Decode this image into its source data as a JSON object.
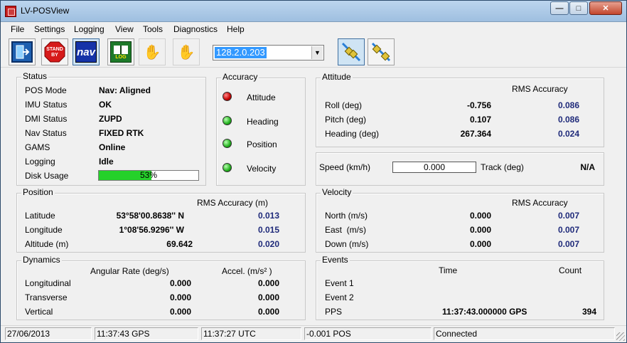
{
  "window": {
    "title": "LV-POSView"
  },
  "menu": [
    "File",
    "Settings",
    "Logging",
    "View",
    "Tools",
    "Diagnostics",
    "Help"
  ],
  "toolbar": {
    "ip_address": "128.2.0.203",
    "standby_label": "STAND BY",
    "nav_label": "nav",
    "log_label": "LOG"
  },
  "status": {
    "title": "Status",
    "rows": [
      {
        "label": "POS Mode",
        "value": "Nav: Aligned"
      },
      {
        "label": "IMU Status",
        "value": "OK"
      },
      {
        "label": "DMI Status",
        "value": "ZUPD"
      },
      {
        "label": "Nav Status",
        "value": "FIXED RTK"
      },
      {
        "label": "GAMS",
        "value": "Online"
      },
      {
        "label": "Logging",
        "value": "Idle"
      }
    ],
    "disk_usage_label": "Disk Usage",
    "disk_usage_percent": 53,
    "disk_usage_text": "53%"
  },
  "accuracy": {
    "title": "Accuracy",
    "items": [
      {
        "label": "Attitude",
        "status": "red"
      },
      {
        "label": "Heading",
        "status": "green"
      },
      {
        "label": "Position",
        "status": "green"
      },
      {
        "label": "Velocity",
        "status": "green"
      }
    ]
  },
  "attitude": {
    "title": "Attitude",
    "rms_header": "RMS Accuracy",
    "rows": [
      {
        "label": "Roll (deg)",
        "value": "-0.756",
        "rms": "0.086"
      },
      {
        "label": "Pitch (deg)",
        "value": "0.107",
        "rms": "0.086"
      },
      {
        "label": "Heading (deg)",
        "value": "267.364",
        "rms": "0.024"
      }
    ]
  },
  "speed": {
    "speed_label": "Speed (km/h)",
    "speed_value": "0.000",
    "track_label": "Track (deg)",
    "track_value": "N/A"
  },
  "position": {
    "title": "Position",
    "rms_header": "RMS Accuracy (m)",
    "rows": [
      {
        "label": "Latitude",
        "value": "53°58'00.8638'' N",
        "rms": "0.013"
      },
      {
        "label": "Longitude",
        "value": "1°08'56.9296'' W",
        "rms": "0.015"
      },
      {
        "label": "Altitude (m)",
        "value": "69.642",
        "rms": "0.020"
      }
    ]
  },
  "velocity": {
    "title": "Velocity",
    "rms_header": "RMS Accuracy",
    "rows": [
      {
        "label": "North (m/s)",
        "value": "0.000",
        "rms": "0.007"
      },
      {
        "label": "East  (m/s)",
        "value": "0.000",
        "rms": "0.007"
      },
      {
        "label": "Down (m/s)",
        "value": "0.000",
        "rms": "0.007"
      }
    ]
  },
  "dynamics": {
    "title": "Dynamics",
    "col1_header": "Angular Rate (deg/s)",
    "col2_header": "Accel. (m/s² )",
    "rows": [
      {
        "label": "Longitudinal",
        "rate": "0.000",
        "accel": "0.000"
      },
      {
        "label": "Transverse",
        "rate": "0.000",
        "accel": "0.000"
      },
      {
        "label": "Vertical",
        "rate": "0.000",
        "accel": "0.000"
      }
    ]
  },
  "events": {
    "title": "Events",
    "time_header": "Time",
    "count_header": "Count",
    "rows": [
      {
        "label": "Event 1",
        "time": "",
        "count": ""
      },
      {
        "label": "Event 2",
        "time": "",
        "count": ""
      },
      {
        "label": "PPS",
        "time": "11:37:43.000000 GPS",
        "count": "394"
      }
    ]
  },
  "statusbar": {
    "date": "27/06/2013",
    "gps_time": "11:37:43 GPS",
    "utc_time": "11:37:27 UTC",
    "pos": "-0.001 POS",
    "connection": "Connected"
  },
  "colors": {
    "accent_blue": "#1f2a7a",
    "disk_fill": "#25d12a",
    "selection": "#3399ff"
  }
}
